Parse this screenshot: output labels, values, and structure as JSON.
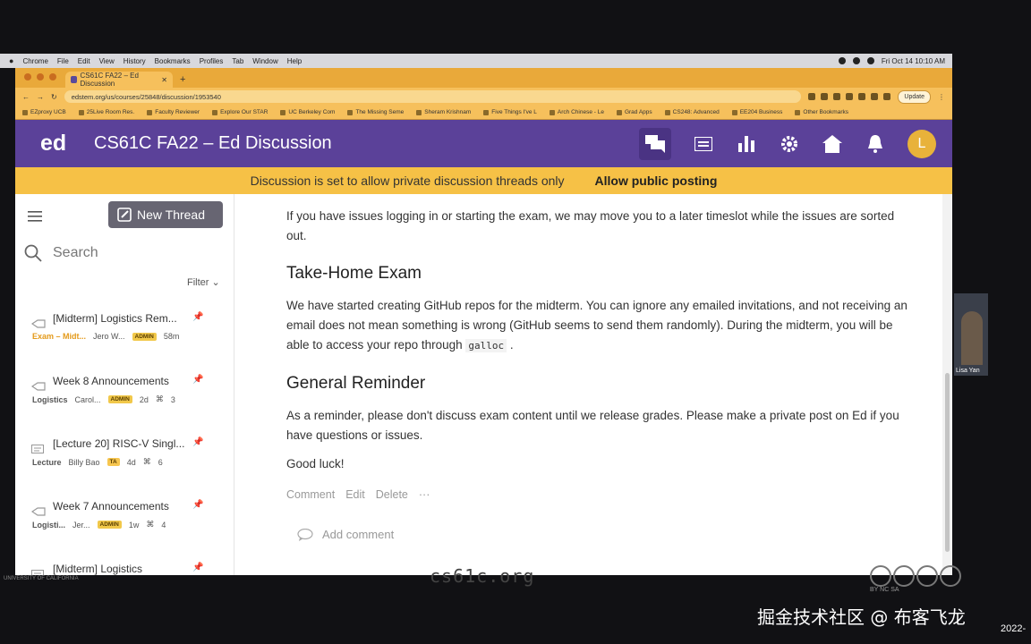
{
  "menubar": {
    "items": [
      "Chrome",
      "File",
      "Edit",
      "View",
      "History",
      "Bookmarks",
      "Profiles",
      "Tab",
      "Window",
      "Help"
    ],
    "clock": "Fri Oct 14  10:10 AM"
  },
  "browser": {
    "tab_title": "CS61C FA22 – Ed Discussion",
    "url": "edstem.org/us/courses/25848/discussion/1953540",
    "update_label": "Update",
    "bookmarks": [
      "EZproxy UCB",
      "25Live Room Res.",
      "Faculty Reviewer",
      "Explore Our STAR",
      "UC Berkeley Com",
      "The Missing Seme",
      "Sheram Krishnam",
      "Five Things I've L",
      "Arch Chinese - Le",
      "Grad Apps",
      "CS248: Advanced",
      "EE204 Business",
      "Other Bookmarks"
    ]
  },
  "header": {
    "logo": "ed",
    "title": "CS61C FA22 – Ed Discussion",
    "avatar_letter": "L"
  },
  "banner": {
    "message": "Discussion is set to allow private discussion threads only",
    "action": "Allow public posting"
  },
  "sidebar": {
    "new_thread": "New Thread",
    "search_placeholder": "Search",
    "filter": "Filter",
    "threads": [
      {
        "title": "[Midterm] Logistics Rem...",
        "category": "Exam – Midt...",
        "author": "Jero W...",
        "badge": "ADMIN",
        "time": "58m",
        "count": ""
      },
      {
        "title": "Week 8 Announcements",
        "category": "Logistics",
        "author": "Carol...",
        "badge": "ADMIN",
        "time": "2d",
        "count": "3"
      },
      {
        "title": "[Lecture 20] RISC-V Singl...",
        "category": "Lecture",
        "author": "Billy Bao",
        "badge": "TA",
        "time": "4d",
        "count": "6"
      },
      {
        "title": "Week 7 Announcements",
        "category": "Logisti...",
        "author": "Jer...",
        "badge": "ADMIN",
        "time": "1w",
        "count": "4"
      },
      {
        "title": "[Midterm] Logistics",
        "category": "",
        "author": "",
        "badge": "",
        "time": "",
        "count": ""
      }
    ]
  },
  "post": {
    "intro": "If you have issues logging in or starting the exam, we may move you to a later timeslot while the issues are sorted out.",
    "h_take_home": "Take-Home Exam",
    "take_home_1": "We have started creating GitHub repos for the midterm. You can ignore any emailed invitations, and not receiving an email does not mean something is wrong (GitHub seems to send them randomly). During the midterm, you will be able to access your repo through",
    "take_home_code": "galloc",
    "take_home_end": ".",
    "h_reminder": "General Reminder",
    "reminder": "As a reminder, please don't discuss exam content until we release grades. Please make a private post on Ed if you have questions or issues.",
    "good_luck": "Good luck!",
    "actions": {
      "comment": "Comment",
      "edit": "Edit",
      "delete": "Delete",
      "more": "···"
    },
    "add_comment": "Add comment"
  },
  "overlay": {
    "bottom_text": "cs61c.org",
    "university": "UNIVERSITY OF CALIFORNIA",
    "cc_label": "BY  NC  SA",
    "webcam_name": "Lisa Yan",
    "watermark": "掘金技术社区 @ 布客飞龙",
    "date": "2022-"
  },
  "colors": {
    "ed_purple": "#5b4199",
    "banner_yellow": "#f6c146",
    "browser_orange": "#f6c05c"
  }
}
